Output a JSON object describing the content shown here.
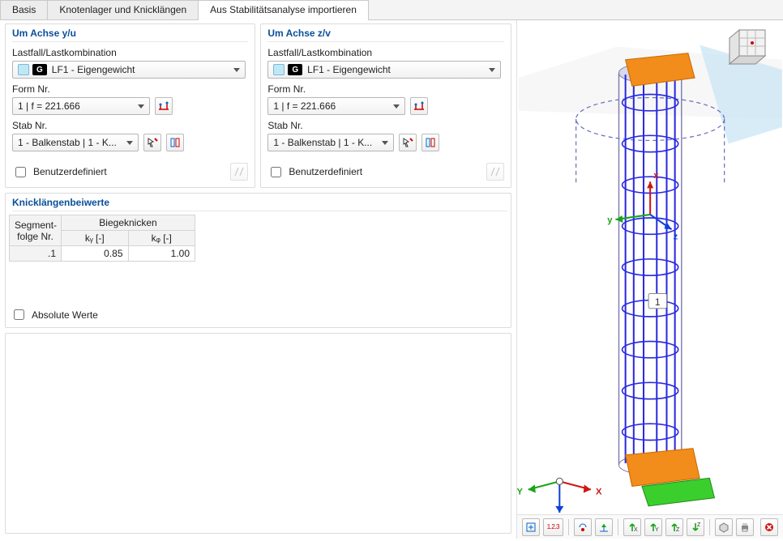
{
  "tabs": {
    "basis": "Basis",
    "knoten": "Knotenlager und Knicklängen",
    "import": "Aus Stabilitätsanalyse importieren"
  },
  "axisY": {
    "title": "Um Achse y/u",
    "loadcase_label": "Lastfall/Lastkombination",
    "loadcase_g": "G",
    "loadcase_value": "LF1 - Eigengewicht",
    "form_label": "Form Nr.",
    "form_value": "1 | f = 221.666",
    "member_label": "Stab Nr.",
    "member_value": "1 - Balkenstab | 1 - K...",
    "userdef": "Benutzerdefiniert"
  },
  "axisZ": {
    "title": "Um Achse z/v",
    "loadcase_label": "Lastfall/Lastkombination",
    "loadcase_g": "G",
    "loadcase_value": "LF1 - Eigengewicht",
    "form_label": "Form Nr.",
    "form_value": "1 | f = 221.666",
    "member_label": "Stab Nr.",
    "member_value": "1 - Balkenstab | 1 - K...",
    "userdef": "Benutzerdefiniert"
  },
  "ktable": {
    "title": "Knicklängenbeiwerte",
    "seg_hdr1": "Segment-",
    "seg_hdr2": "folge Nr.",
    "group_hdr": "Biegeknicken",
    "ky_hdr": "kᵧ [-]",
    "kz_hdr": "kᵩ [-]",
    "rows": [
      {
        "seg": ".1",
        "ky": "0.85",
        "kz": "1.00"
      }
    ],
    "abs": "Absolute Werte"
  },
  "viewport": {
    "axis_x": "X",
    "axis_y": "Y",
    "axis_z": "Z",
    "member_label": "1"
  },
  "toolbar_labels": {
    "numbers": "1.2.3"
  }
}
